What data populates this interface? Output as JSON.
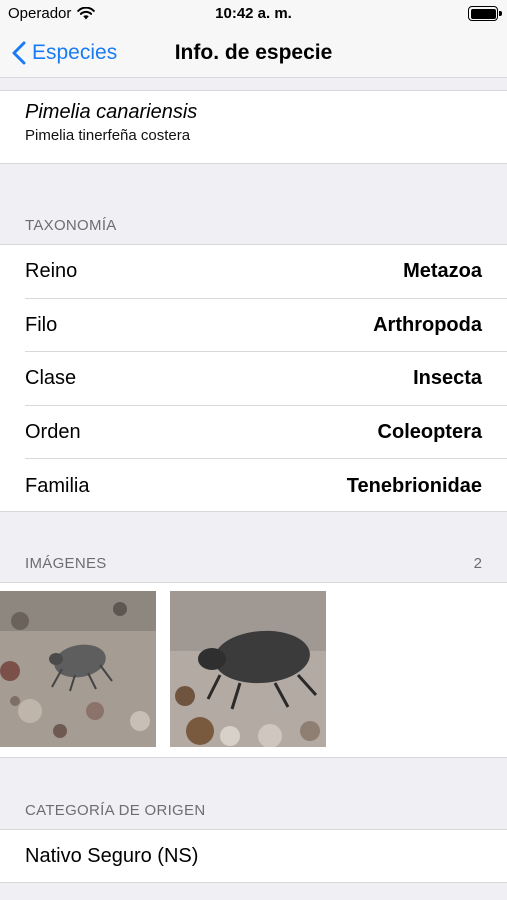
{
  "status_bar": {
    "carrier": "Operador",
    "time": "10:42 a. m."
  },
  "nav": {
    "back_label": "Especies",
    "title": "Info. de especie"
  },
  "species": {
    "scientific_name": "Pimelia canariensis",
    "common_name": "Pimelia tinerfeña costera"
  },
  "taxonomy": {
    "header": "TAXONOMÍA",
    "rows": [
      {
        "label": "Reino",
        "value": "Metazoa"
      },
      {
        "label": "Filo",
        "value": "Arthropoda"
      },
      {
        "label": "Clase",
        "value": "Insecta"
      },
      {
        "label": "Orden",
        "value": "Coleoptera"
      },
      {
        "label": "Familia",
        "value": "Tenebrionidae"
      }
    ]
  },
  "images": {
    "header": "IMÁGENES",
    "count": "2"
  },
  "origin": {
    "header": "CATEGORÍA DE ORIGEN",
    "value": "Nativo Seguro (NS)"
  },
  "colors": {
    "accent": "#1a7cf5",
    "background": "#efeff4",
    "section_text": "#6d6d72"
  }
}
